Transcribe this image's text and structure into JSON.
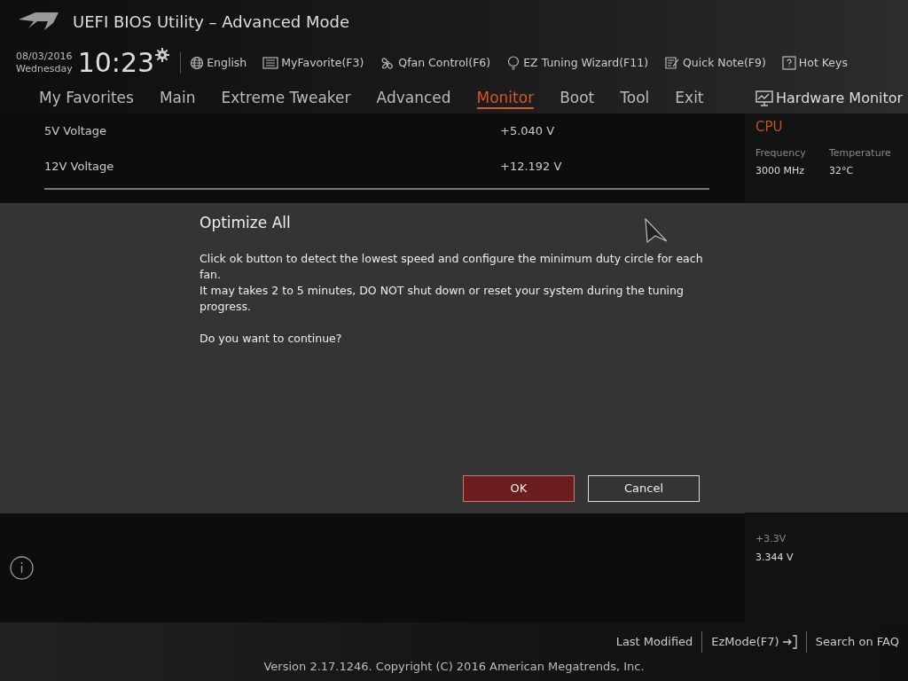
{
  "window": {
    "title": "UEFI BIOS Utility – Advanced Mode"
  },
  "info_bar": {
    "date": "08/03/2016",
    "weekday": "Wednesday",
    "time": "10:23",
    "items": [
      {
        "kind": "globe",
        "label": "English"
      },
      {
        "kind": "list",
        "label": "MyFavorite(F3)"
      },
      {
        "kind": "fan",
        "label": "Qfan Control(F6)"
      },
      {
        "kind": "bulb",
        "label": "EZ Tuning Wizard(F11)"
      },
      {
        "kind": "note",
        "label": "Quick Note(F9)"
      },
      {
        "kind": "help",
        "label": "Hot Keys"
      }
    ]
  },
  "tabs": [
    {
      "label": "My Favorites",
      "selected": false
    },
    {
      "label": "Main",
      "selected": false
    },
    {
      "label": "Extreme Tweaker",
      "selected": false
    },
    {
      "label": "Advanced",
      "selected": false
    },
    {
      "label": "Monitor",
      "selected": true
    },
    {
      "label": "Boot",
      "selected": false
    },
    {
      "label": "Tool",
      "selected": false
    },
    {
      "label": "Exit",
      "selected": false
    }
  ],
  "settings": [
    {
      "name": "5V Voltage",
      "value": "+5.040 V"
    },
    {
      "name": "12V Voltage",
      "value": "+12.192 V"
    }
  ],
  "hardware_monitor": {
    "title": "Hardware Monitor",
    "section": "CPU",
    "readings": [
      {
        "label": "Frequency",
        "value": "3000 MHz"
      },
      {
        "label": "Temperature",
        "value": "32°C"
      }
    ],
    "lower_readings": [
      {
        "label": "+3.3V",
        "value": "3.344 V"
      }
    ]
  },
  "dialog": {
    "title": "Optimize All",
    "paragraphs": [
      "Click ok button to detect the lowest speed and configure the minimum duty circle for each fan.",
      "It may takes 2 to 5 minutes, DO NOT shut down or reset your system during the tuning progress."
    ],
    "question": "Do you want to continue?",
    "buttons": [
      {
        "label": "OK",
        "selected": true
      },
      {
        "label": "Cancel",
        "selected": false
      }
    ]
  },
  "footer": {
    "links": [
      "Last Modified",
      "EzMode(F7)",
      "Search on FAQ"
    ],
    "copyright": "Version 2.17.1246. Copyright (C) 2016 American Megatrends, Inc."
  }
}
